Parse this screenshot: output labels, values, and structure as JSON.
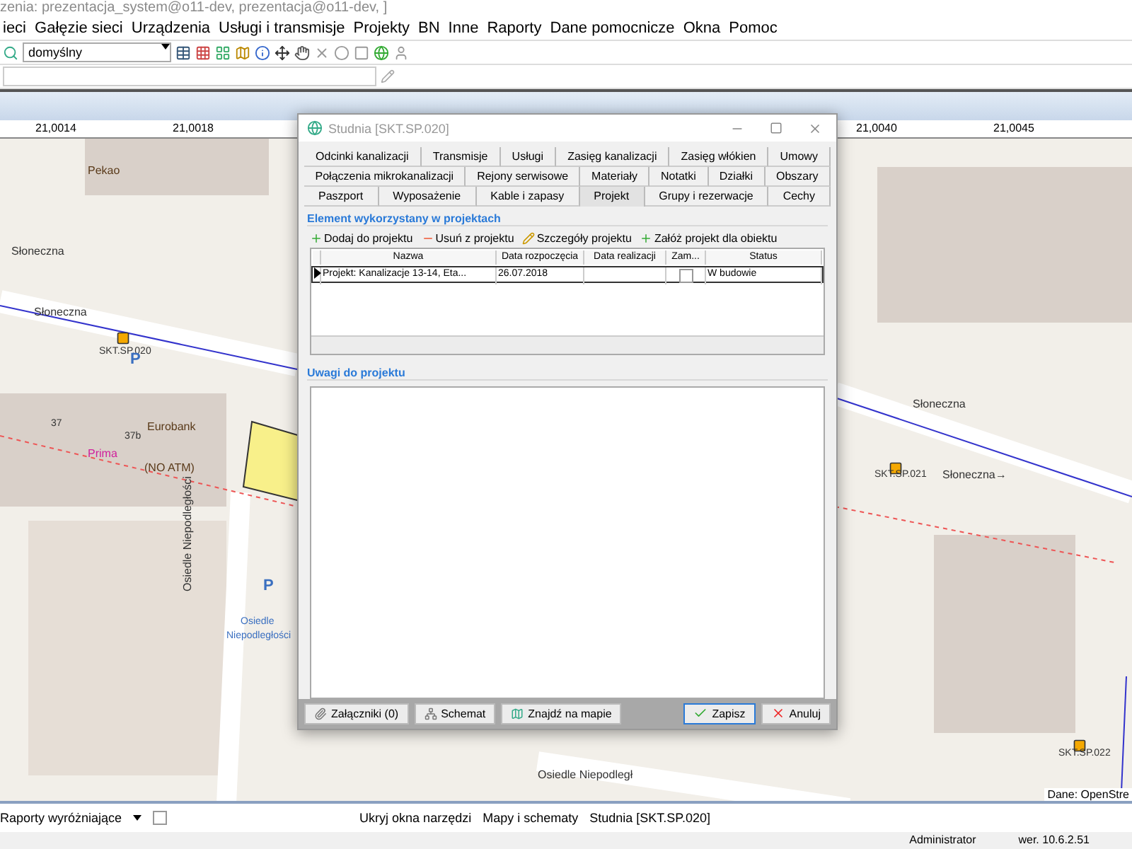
{
  "window": {
    "title": "zenia: prezentacja_system@o11-dev, prezentacja@o11-dev, ]"
  },
  "menu": [
    "ieci",
    "Gałęzie sieci",
    "Urządzenia",
    "Usługi i transmisje",
    "Projekty",
    "BN",
    "Inne",
    "Raporty",
    "Dane pomocnicze",
    "Okna",
    "Pomoc"
  ],
  "toolbar": {
    "combo": "domyślny"
  },
  "ruler": [
    "21,0014",
    "21,0018",
    "21,0040",
    "21,0045"
  ],
  "map": {
    "labels": [
      {
        "text": "Pekao",
        "kind": "poi"
      },
      {
        "text": "Słoneczna",
        "kind": "street"
      },
      {
        "text": "Słoneczna",
        "kind": "street"
      },
      {
        "text": "SKT.SP.020",
        "kind": "object"
      },
      {
        "text": "P",
        "kind": "parking"
      },
      {
        "text": "37",
        "kind": "number"
      },
      {
        "text": "37b",
        "kind": "number"
      },
      {
        "text": "Prima",
        "kind": "shop"
      },
      {
        "text": "Eurobank",
        "kind": "poi"
      },
      {
        "text": "(NO ATM)",
        "kind": "poi"
      },
      {
        "text": "Osiedle Niepodległości",
        "kind": "vertical"
      },
      {
        "text": "P",
        "kind": "parking"
      },
      {
        "text": "Osiedle",
        "kind": "place"
      },
      {
        "text": "Niepodległości",
        "kind": "place"
      },
      {
        "text": "Osiedle Niepodległ",
        "kind": "street"
      },
      {
        "text": "Słoneczna",
        "kind": "street"
      },
      {
        "text": "SKT.SP.021",
        "kind": "object"
      },
      {
        "text": "Słoneczna→",
        "kind": "street"
      },
      {
        "text": "SKT.SP.022",
        "kind": "object"
      }
    ],
    "attribution": "Dane: OpenStre"
  },
  "dialog": {
    "title": "Studnia [SKT.SP.020]",
    "tab_rows": [
      [
        {
          "label": "Odcinki kanalizacji",
          "selected": false
        },
        {
          "label": "Transmisje",
          "selected": false
        },
        {
          "label": "Usługi",
          "selected": false
        },
        {
          "label": "Zasięg kanalizacji",
          "selected": false
        },
        {
          "label": "Zasięg włókien",
          "selected": false
        },
        {
          "label": "Umowy",
          "selected": false
        }
      ],
      [
        {
          "label": "Połączenia mikrokanalizacji",
          "selected": false
        },
        {
          "label": "Rejony serwisowe",
          "selected": false
        },
        {
          "label": "Materiały",
          "selected": false
        },
        {
          "label": "Notatki",
          "selected": false
        },
        {
          "label": "Działki",
          "selected": false
        },
        {
          "label": "Obszary",
          "selected": false
        }
      ],
      [
        {
          "label": "Paszport",
          "selected": false
        },
        {
          "label": "Wyposażenie",
          "selected": false
        },
        {
          "label": "Kable i zapasy",
          "selected": false
        },
        {
          "label": "Projekt",
          "selected": true
        },
        {
          "label": "Grupy i rezerwacje",
          "selected": false
        },
        {
          "label": "Cechy",
          "selected": false
        }
      ]
    ],
    "section": "Element wykorzystany w projektach",
    "actions": [
      {
        "label": "Dodaj do projektu",
        "kind": "add"
      },
      {
        "label": "Usuń z projektu",
        "kind": "remove"
      },
      {
        "label": "Szczegóły projektu",
        "kind": "edit"
      },
      {
        "label": "Załóż projekt dla obiektu",
        "kind": "add"
      }
    ],
    "table": {
      "columns": [
        "Nazwa",
        "Data rozpoczęcia",
        "Data realizacji",
        "Zam...",
        "Status"
      ],
      "rows": [
        {
          "name": "Projekt: Kanalizacje 13-14, Eta...",
          "start": "26.07.2018",
          "end": "",
          "closed": false,
          "status": "W budowie",
          "selected": true
        }
      ]
    },
    "notes_title": "Uwagi do projektu",
    "footer_left": [
      {
        "label": "Załączniki (0)",
        "kind": "clip"
      },
      {
        "label": "Schemat",
        "kind": "scheme"
      },
      {
        "label": "Znajdź na mapie",
        "kind": "map"
      }
    ],
    "footer_right": [
      {
        "label": "Zapisz",
        "kind": "ok",
        "default": true
      },
      {
        "label": "Anuluj",
        "kind": "cancel",
        "default": false
      }
    ]
  },
  "status_bar": {
    "reports": "Raporty wyróżniające",
    "checked": false,
    "items": [
      "Ukryj okna narzędzi",
      "Mapy i schematy",
      "Studnia [SKT.SP.020]"
    ]
  },
  "bottom": {
    "user": "Administrator",
    "version": "wer. 10.6.2.51"
  }
}
